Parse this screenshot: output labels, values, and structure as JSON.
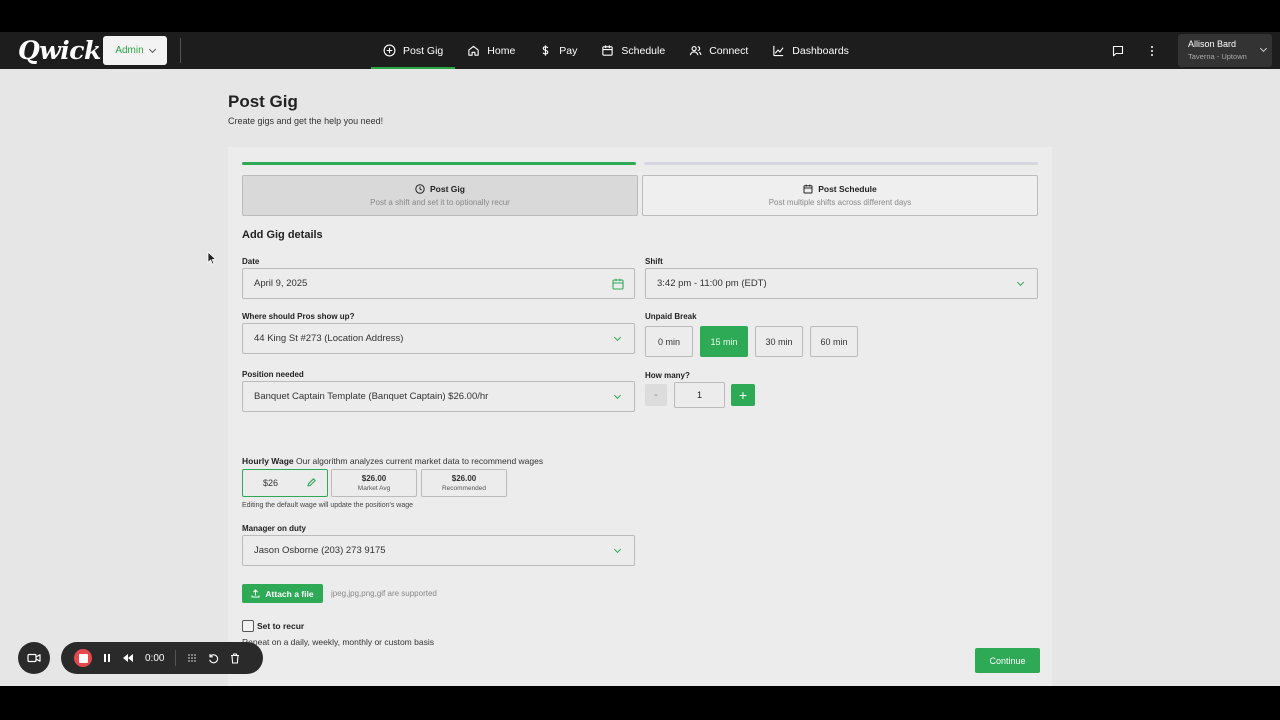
{
  "app": {
    "logo": "Qwick",
    "admin_label": "Admin"
  },
  "nav": [
    {
      "label": "Post Gig",
      "icon": "plus-circle-icon",
      "active": true
    },
    {
      "label": "Home",
      "icon": "home-icon",
      "active": false
    },
    {
      "label": "Pay",
      "icon": "dollar-icon",
      "active": false
    },
    {
      "label": "Schedule",
      "icon": "calendar-icon",
      "active": false
    },
    {
      "label": "Connect",
      "icon": "people-icon",
      "active": false
    },
    {
      "label": "Dashboards",
      "icon": "chart-icon",
      "active": false
    }
  ],
  "user": {
    "name": "Allison Bard",
    "location": "Taverna - Uptown"
  },
  "page": {
    "title": "Post Gig",
    "subtitle": "Create gigs and get the help you need!"
  },
  "modes": {
    "gig": {
      "title": "Post Gig",
      "desc": "Post a shift and set it to optionally recur"
    },
    "schedule": {
      "title": "Post Schedule",
      "desc": "Post multiple shifts across different days"
    }
  },
  "form": {
    "section_title": "Add Gig details",
    "date": {
      "label": "Date",
      "value": "April 9, 2025"
    },
    "shift": {
      "label": "Shift",
      "value": "3:42 pm - 11:00 pm (EDT)"
    },
    "location": {
      "label": "Where should Pros show up?",
      "value": "44 King St #273 (Location Address)"
    },
    "break": {
      "label": "Unpaid Break",
      "options": [
        "0 min",
        "15 min",
        "30 min",
        "60 min"
      ],
      "selected": "15 min"
    },
    "position": {
      "label": "Position needed",
      "value": "Banquet Captain Template (Banquet Captain) $26.00/hr"
    },
    "how_many": {
      "label": "How many?",
      "value": "1",
      "minus": "-",
      "plus": "+"
    },
    "wage": {
      "label": "Hourly Wage",
      "hint": "Our algorithm analyzes current market data to recommend wages",
      "value": "$26",
      "market_value": "$26.00",
      "market_label": "Market Avg",
      "rec_value": "$26.00",
      "rec_label": "Recommended",
      "note": "Editing the default wage will update the position's wage"
    },
    "manager": {
      "label": "Manager on duty",
      "value": "Jason Osborne (203) 273 9175"
    },
    "attach": {
      "label": "Attach a file",
      "note": "jpeg,jpg,png,gif are supported"
    },
    "recur": {
      "label": "Set to recur",
      "desc": "Repeat on a daily, weekly, monthly or custom basis",
      "checked": false
    }
  },
  "continue_label": "Continue",
  "recorder": {
    "time": "0:00"
  },
  "colors": {
    "accent": "#2eaa57",
    "topbar": "#1d1d1d",
    "background": "#e6e6e6"
  }
}
